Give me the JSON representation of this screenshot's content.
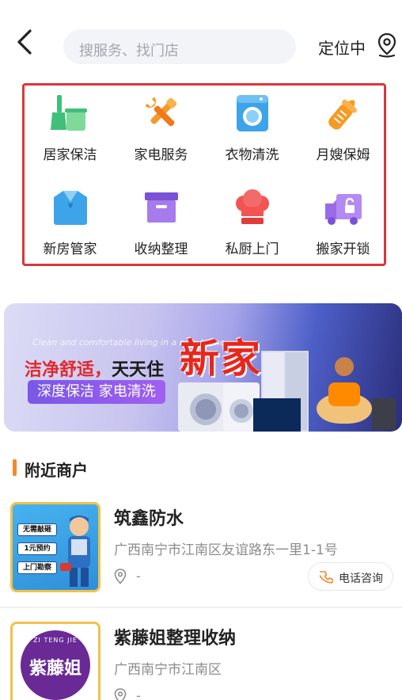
{
  "header": {
    "search_placeholder": "搜服务、找门店",
    "location_label": "定位中"
  },
  "services": [
    {
      "label": "居家保洁",
      "icon": "cleaning-broom-icon"
    },
    {
      "label": "家电服务",
      "icon": "tools-icon"
    },
    {
      "label": "衣物清洗",
      "icon": "washing-machine-icon"
    },
    {
      "label": "月嫂保姆",
      "icon": "baby-bottle-icon"
    },
    {
      "label": "新房管家",
      "icon": "shirt-icon"
    },
    {
      "label": "收纳整理",
      "icon": "storage-box-icon"
    },
    {
      "label": "私厨上门",
      "icon": "chef-hat-icon"
    },
    {
      "label": "搬家开锁",
      "icon": "moving-truck-icon"
    }
  ],
  "banner": {
    "slogan_part1": "洁净舒适，",
    "slogan_part2": "天天住",
    "tags": "深度保洁 家电清洗",
    "headline": "新家",
    "script_text": "Clean and comfortable living in a new home"
  },
  "section": {
    "title": "附近商户"
  },
  "merchants": [
    {
      "name": "筑鑫防水",
      "address": "广西南宁市江南区友谊路东一里1-1号",
      "distance": "-",
      "call_label": "电话咨询",
      "thumb_tags": [
        "无需敲砸",
        "1元预约",
        "上门勘察"
      ]
    },
    {
      "name": "紫藤姐整理收纳",
      "address": "广西南宁市江南区",
      "distance": "-",
      "thumb_text": "紫藤姐",
      "thumb_arc": "ZI TENG JIE"
    }
  ]
}
